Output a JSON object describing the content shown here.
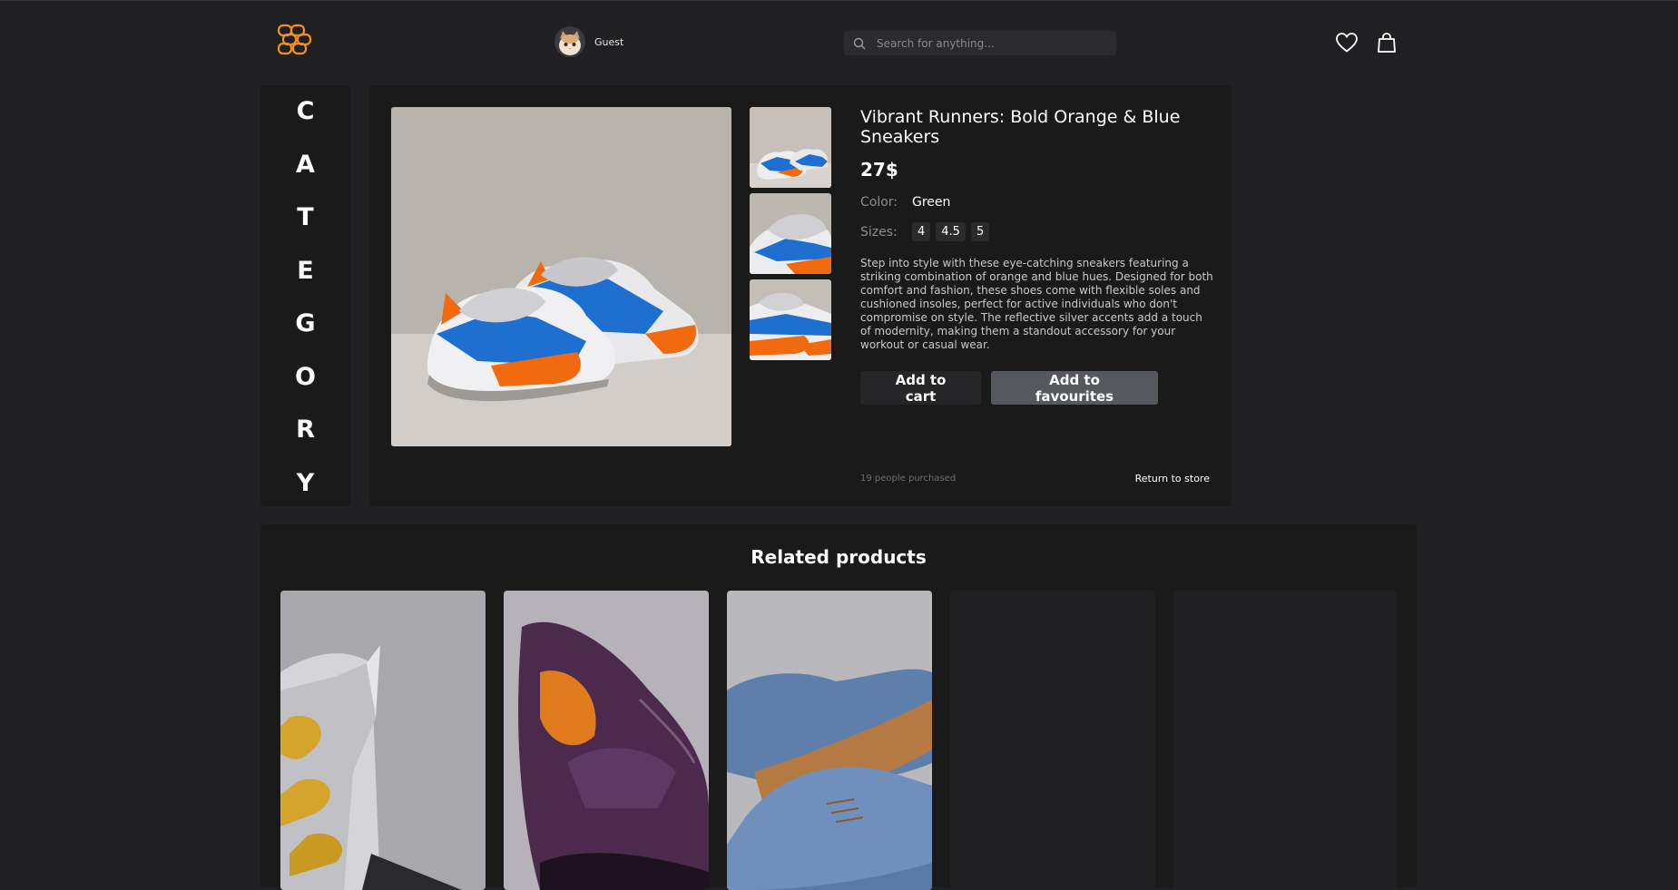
{
  "header": {
    "logo_icon": "brand-logo",
    "profile": {
      "name": "Guest",
      "avatar_icon": "cat-avatar"
    },
    "search": {
      "placeholder": "Search for anything...",
      "value": ""
    },
    "icons": [
      "heart-icon",
      "shopping-bag-icon"
    ]
  },
  "category": {
    "letters": [
      "C",
      "A",
      "T",
      "E",
      "G",
      "O",
      "R",
      "Y"
    ]
  },
  "product": {
    "title": "Vibrant Runners: Bold Orange & Blue Sneakers",
    "price": "27$",
    "color_label": "Color:",
    "color_value": "Green",
    "sizes_label": "Sizes:",
    "sizes": [
      "4",
      "4.5",
      "5"
    ],
    "description": "Step into style with these eye-catching sneakers featuring a striking combination of orange and blue hues. Designed for both comfort and fashion, these shoes come with flexible soles and cushioned insoles, perfect for active individuals who don't compromise on style. The reflective silver accents add a touch of modernity, making them a standout accessory for your workout or casual wear.",
    "add_to_cart": "Add to cart",
    "add_to_favourites": "Add to favourites",
    "purchased": "19 people purchased",
    "return": "Return to store"
  },
  "related": {
    "title": "Related products",
    "cards": [
      "silver-gold-boot-image",
      "purple-loafer-image",
      "blue-suede-shoe-image",
      "empty-card",
      "empty-card"
    ]
  },
  "colors": {
    "background": "#202022",
    "panel": "#1a1a1b",
    "accent": "#f39019",
    "fav_button": "#55585d"
  }
}
